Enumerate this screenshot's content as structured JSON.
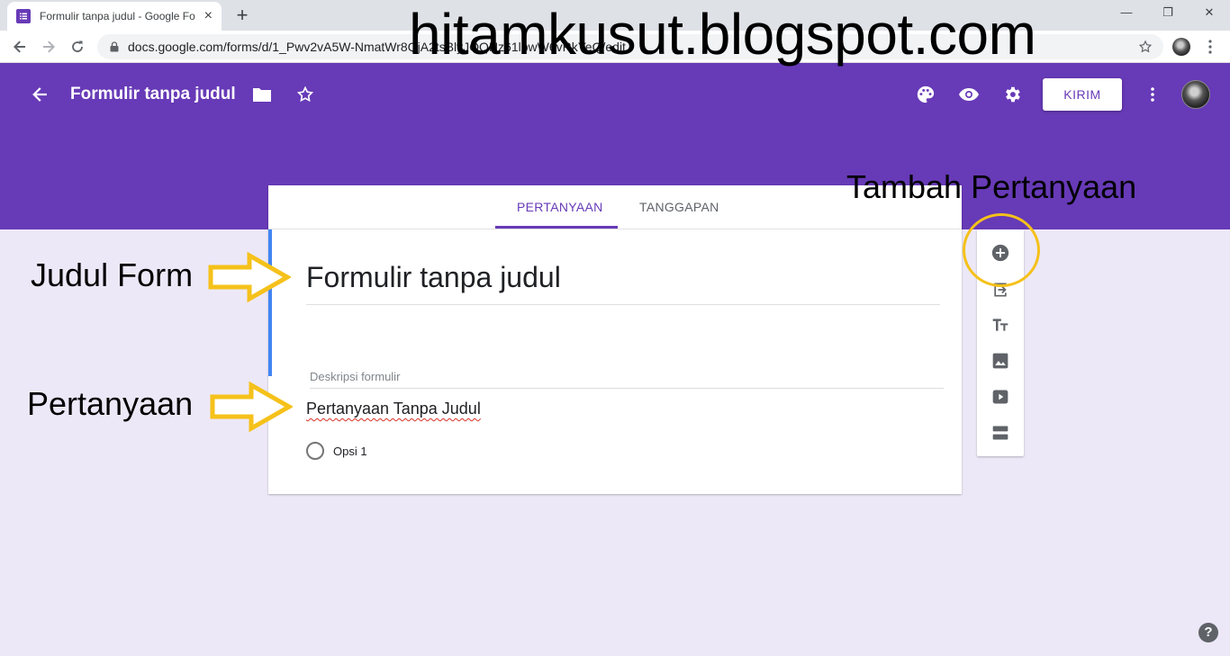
{
  "browser": {
    "tab_title": "Formulir tanpa judul - Google Fo",
    "tab_close": "×",
    "new_tab": "+",
    "url": "docs.google.com/forms/d/1_Pwv2vA5W-NmatWr8QjA2tsBlyJOQHz61lpwW6vRkYeQ/edit",
    "win_minimize": "—",
    "win_restore": "❐",
    "win_close": "✕"
  },
  "header": {
    "form_title": "Formulir tanpa judul",
    "send_button": "KIRIM",
    "theme_color": "#673ab7"
  },
  "tabs": {
    "questions": "PERTANYAAN",
    "responses": "TANGGAPAN"
  },
  "form": {
    "title": "Formulir tanpa judul",
    "description_placeholder": "Deskripsi formulir",
    "question_title": "Pertanyaan Tanpa Judul",
    "option_1": "Opsi 1"
  },
  "annotations": {
    "watermark": "hitamkusut.blogspot.com",
    "title_label": "Judul Form",
    "question_label": "Pertanyaan",
    "add_question_label": "Tambah Pertanyaan",
    "highlight_color": "#f5c11a"
  },
  "help_label": "?"
}
